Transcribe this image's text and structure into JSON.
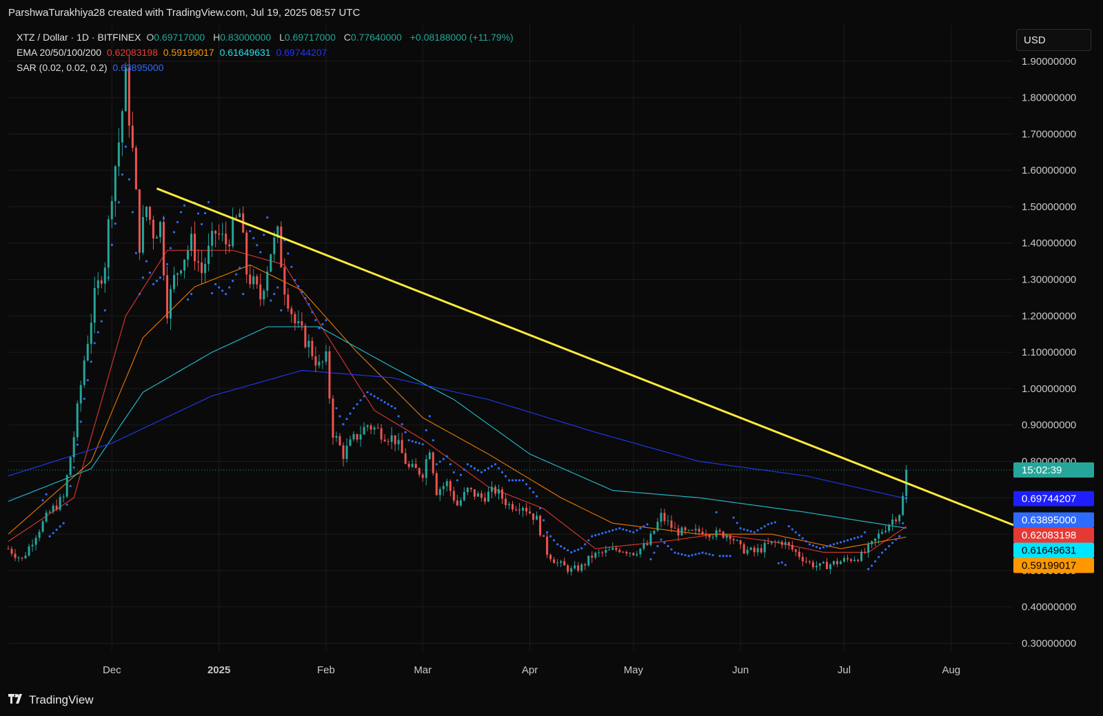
{
  "header": {
    "attribution": "ParshwaTurakhiya28 created with TradingView.com, Jul 19, 2025 08:57 UTC"
  },
  "legend": {
    "symbol": "XTZ / Dollar · 1D · BITFINEX",
    "o_label": "O",
    "o_value": "0.69717000",
    "h_label": "H",
    "h_value": "0.83000000",
    "l_label": "L",
    "l_value": "0.69717000",
    "c_label": "C",
    "c_value": "0.77640000",
    "change": "+0.08188000 (+11.79%)",
    "ema_label": "EMA 20/50/100/200",
    "ema20": "0.62083198",
    "ema50": "0.59199017",
    "ema100": "0.61649631",
    "ema200": "0.69744207",
    "sar_label": "SAR (0.02, 0.02, 0.2)",
    "sar_value": "0.63895000"
  },
  "currency_button": "USD",
  "brand": "TradingView",
  "colors": {
    "background": "#0a0a0a",
    "up": "#26a69a",
    "down": "#ef5350",
    "ema20": "#e53935",
    "ema50": "#f57c00",
    "ema100": "#26c6da",
    "ema200": "#1e3cff",
    "sar": "#2f6bff",
    "trendline": "#ffeb3b"
  },
  "chart_data": {
    "type": "candlestick",
    "y_axis": {
      "ticks": [
        "0.30000000",
        "0.40000000",
        "0.50000000",
        "0.60000000",
        "0.70000000",
        "0.80000000",
        "0.90000000",
        "1.00000000",
        "1.10000000",
        "1.20000000",
        "1.30000000",
        "1.40000000",
        "1.50000000",
        "1.60000000",
        "1.70000000",
        "1.80000000",
        "1.90000000"
      ],
      "range": [
        0.28,
        2.0
      ]
    },
    "x_axis": {
      "ticks": [
        {
          "label": "Dec",
          "date": "2024-12-01"
        },
        {
          "label": "2025",
          "date": "2025-01-01",
          "bold": true
        },
        {
          "label": "Feb",
          "date": "2025-02-01"
        },
        {
          "label": "Mar",
          "date": "2025-03-01"
        },
        {
          "label": "Apr",
          "date": "2025-04-01"
        },
        {
          "label": "May",
          "date": "2025-05-01"
        },
        {
          "label": "Jun",
          "date": "2025-06-01"
        },
        {
          "label": "Jul",
          "date": "2025-07-01"
        },
        {
          "label": "Aug",
          "date": "2025-08-01"
        }
      ],
      "range": [
        "2024-11-01",
        "2025-08-19"
      ]
    },
    "close_path": [
      [
        "2024-11-01",
        0.56
      ],
      [
        "2024-11-05",
        0.53
      ],
      [
        "2024-11-09",
        0.6
      ],
      [
        "2024-11-13",
        0.66
      ],
      [
        "2024-11-17",
        0.7
      ],
      [
        "2024-11-20",
        0.87
      ],
      [
        "2024-11-23",
        1.08
      ],
      [
        "2024-11-26",
        1.25
      ],
      [
        "2024-11-29",
        1.35
      ],
      [
        "2024-12-01",
        1.55
      ],
      [
        "2024-12-03",
        1.68
      ],
      [
        "2024-12-05",
        1.85
      ],
      [
        "2024-12-07",
        1.65
      ],
      [
        "2024-12-09",
        1.4
      ],
      [
        "2024-12-11",
        1.5
      ],
      [
        "2024-12-13",
        1.43
      ],
      [
        "2024-12-15",
        1.45
      ],
      [
        "2024-12-17",
        1.22
      ],
      [
        "2024-12-19",
        1.3
      ],
      [
        "2024-12-21",
        1.35
      ],
      [
        "2024-12-24",
        1.4
      ],
      [
        "2024-12-27",
        1.32
      ],
      [
        "2024-12-31",
        1.43
      ],
      [
        "2025-01-03",
        1.4
      ],
      [
        "2025-01-07",
        1.48
      ],
      [
        "2025-01-09",
        1.32
      ],
      [
        "2025-01-13",
        1.25
      ],
      [
        "2025-01-16",
        1.38
      ],
      [
        "2025-01-18",
        1.42
      ],
      [
        "2025-01-20",
        1.28
      ],
      [
        "2025-01-23",
        1.18
      ],
      [
        "2025-01-27",
        1.12
      ],
      [
        "2025-01-30",
        1.06
      ],
      [
        "2025-02-01",
        1.08
      ],
      [
        "2025-02-03",
        0.88
      ],
      [
        "2025-02-06",
        0.82
      ],
      [
        "2025-02-09",
        0.86
      ],
      [
        "2025-02-13",
        0.9
      ],
      [
        "2025-02-17",
        0.88
      ],
      [
        "2025-02-21",
        0.86
      ],
      [
        "2025-02-25",
        0.78
      ],
      [
        "2025-03-01",
        0.77
      ],
      [
        "2025-03-03",
        0.84
      ],
      [
        "2025-03-05",
        0.72
      ],
      [
        "2025-03-08",
        0.74
      ],
      [
        "2025-03-11",
        0.68
      ],
      [
        "2025-03-14",
        0.72
      ],
      [
        "2025-03-18",
        0.7
      ],
      [
        "2025-03-22",
        0.72
      ],
      [
        "2025-03-26",
        0.68
      ],
      [
        "2025-03-30",
        0.68
      ],
      [
        "2025-04-03",
        0.64
      ],
      [
        "2025-04-06",
        0.55
      ],
      [
        "2025-04-09",
        0.52
      ],
      [
        "2025-04-13",
        0.5
      ],
      [
        "2025-04-16",
        0.51
      ],
      [
        "2025-04-19",
        0.54
      ],
      [
        "2025-04-23",
        0.55
      ],
      [
        "2025-04-27",
        0.56
      ],
      [
        "2025-05-01",
        0.55
      ],
      [
        "2025-05-05",
        0.57
      ],
      [
        "2025-05-09",
        0.65
      ],
      [
        "2025-05-13",
        0.61
      ],
      [
        "2025-05-17",
        0.6
      ],
      [
        "2025-05-21",
        0.61
      ],
      [
        "2025-05-25",
        0.6
      ],
      [
        "2025-05-29",
        0.6
      ],
      [
        "2025-06-01",
        0.56
      ],
      [
        "2025-06-05",
        0.55
      ],
      [
        "2025-06-09",
        0.57
      ],
      [
        "2025-06-13",
        0.58
      ],
      [
        "2025-06-17",
        0.55
      ],
      [
        "2025-06-21",
        0.52
      ],
      [
        "2025-06-24",
        0.51
      ],
      [
        "2025-06-28",
        0.52
      ],
      [
        "2025-07-02",
        0.53
      ],
      [
        "2025-07-06",
        0.54
      ],
      [
        "2025-07-09",
        0.57
      ],
      [
        "2025-07-12",
        0.61
      ],
      [
        "2025-07-15",
        0.64
      ],
      [
        "2025-07-17",
        0.66
      ],
      [
        "2025-07-18",
        0.7
      ],
      [
        "2025-07-19",
        0.7764
      ]
    ],
    "ema_paths": {
      "ema20": [
        [
          "2024-11-01",
          0.58
        ],
        [
          "2024-11-20",
          0.7
        ],
        [
          "2024-12-05",
          1.2
        ],
        [
          "2024-12-17",
          1.38
        ],
        [
          "2025-01-05",
          1.38
        ],
        [
          "2025-01-20",
          1.34
        ],
        [
          "2025-02-01",
          1.15
        ],
        [
          "2025-02-15",
          0.94
        ],
        [
          "2025-03-01",
          0.86
        ],
        [
          "2025-03-20",
          0.73
        ],
        [
          "2025-04-05",
          0.67
        ],
        [
          "2025-04-20",
          0.56
        ],
        [
          "2025-05-10",
          0.58
        ],
        [
          "2025-05-25",
          0.6
        ],
        [
          "2025-06-10",
          0.58
        ],
        [
          "2025-06-25",
          0.55
        ],
        [
          "2025-07-08",
          0.55
        ],
        [
          "2025-07-19",
          0.6208
        ]
      ],
      "ema50": [
        [
          "2024-11-01",
          0.6
        ],
        [
          "2024-11-25",
          0.8
        ],
        [
          "2024-12-10",
          1.14
        ],
        [
          "2024-12-25",
          1.28
        ],
        [
          "2025-01-10",
          1.34
        ],
        [
          "2025-01-25",
          1.27
        ],
        [
          "2025-02-10",
          1.1
        ],
        [
          "2025-03-01",
          0.92
        ],
        [
          "2025-03-20",
          0.82
        ],
        [
          "2025-04-10",
          0.7
        ],
        [
          "2025-04-25",
          0.63
        ],
        [
          "2025-05-20",
          0.6
        ],
        [
          "2025-06-10",
          0.6
        ],
        [
          "2025-06-30",
          0.56
        ],
        [
          "2025-07-19",
          0.592
        ]
      ],
      "ema100": [
        [
          "2024-11-01",
          0.69
        ],
        [
          "2024-11-25",
          0.78
        ],
        [
          "2024-12-10",
          0.99
        ],
        [
          "2024-12-30",
          1.1
        ],
        [
          "2025-01-15",
          1.17
        ],
        [
          "2025-01-30",
          1.17
        ],
        [
          "2025-02-20",
          1.06
        ],
        [
          "2025-03-10",
          0.97
        ],
        [
          "2025-04-01",
          0.82
        ],
        [
          "2025-04-25",
          0.72
        ],
        [
          "2025-05-20",
          0.7
        ],
        [
          "2025-06-20",
          0.66
        ],
        [
          "2025-07-19",
          0.6165
        ]
      ],
      "ema200": [
        [
          "2024-11-01",
          0.76
        ],
        [
          "2024-12-01",
          0.85
        ],
        [
          "2024-12-30",
          0.98
        ],
        [
          "2025-01-25",
          1.05
        ],
        [
          "2025-02-20",
          1.03
        ],
        [
          "2025-03-20",
          0.97
        ],
        [
          "2025-04-20",
          0.88
        ],
        [
          "2025-05-20",
          0.8
        ],
        [
          "2025-06-20",
          0.76
        ],
        [
          "2025-07-19",
          0.6974
        ]
      ]
    },
    "trendline": {
      "start": [
        "2024-12-14",
        1.55
      ],
      "end": [
        "2025-08-19",
        0.625
      ]
    },
    "last_price_line": {
      "value": 0.7764,
      "countdown": "15:02:39"
    },
    "price_badges": [
      {
        "value": "0.69744207",
        "y": 0.69744,
        "color": "#1e1eff",
        "text": "#ffffff"
      },
      {
        "value": "0.63895000",
        "y": 0.63895,
        "color": "#2f6bff",
        "text": "#ffffff"
      },
      {
        "value": "0.62083198",
        "y": 0.6208,
        "color": "#e53935",
        "text": "#ffffff"
      },
      {
        "value": "0.61649631",
        "y": 0.6165,
        "color": "#00e5ff",
        "text": "#000000"
      },
      {
        "value": "0.59199017",
        "y": 0.592,
        "color": "#ff9800",
        "text": "#000000"
      }
    ]
  }
}
